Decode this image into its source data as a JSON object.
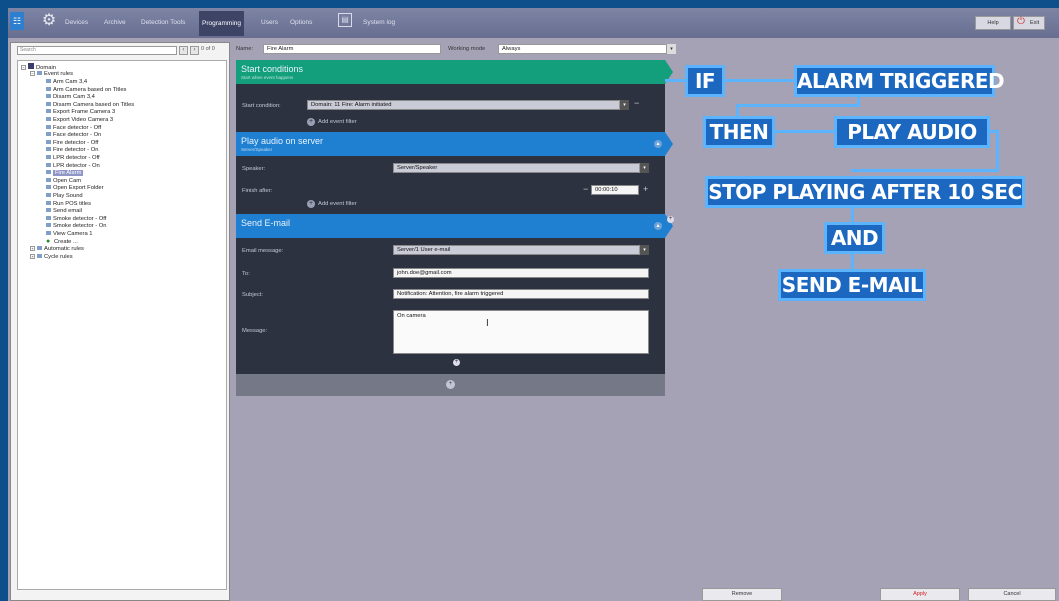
{
  "topbar": {
    "tabs": [
      "Devices",
      "Archive",
      "Detection Tools",
      "Programming",
      "Users",
      "Options"
    ],
    "active_tab": "Programming",
    "system_log": "System log",
    "help": "Help",
    "exit": "Exit",
    "logo_glyph": "☷",
    "gear_glyph": "⚙"
  },
  "tree_panel": {
    "search_placeholder": "Search",
    "count": "0 of 0",
    "prev_glyph": "‹",
    "next_glyph": "›",
    "root": "Domain",
    "event_rules": "Event rules",
    "items": [
      "Arm Cam 3,4",
      "Arm Camera based on Titles",
      "Disarm Cam 3,4",
      "Disarm Camera based on Titles",
      "Export Frame Camera 3",
      "Export Video Camera 3",
      "Face detector - Off",
      "Face detector - On",
      "Fire detector - Off",
      "Fire detector - On",
      "LPR detector - Off",
      "LPR detector - On",
      "Fire Alarm",
      "Open Cam",
      "Open Export Folder",
      "Play Sound",
      "Run POS titles",
      "Send email",
      "Smoke detector - Off",
      "Smoke detector - On",
      "View Camera 1"
    ],
    "create": "Create ...",
    "automatic_rules": "Automatic rules",
    "cycle_rules": "Cycle rules"
  },
  "name_bar": {
    "name_label": "Name:",
    "name_value": "Fire Alarm",
    "mode_label": "Working mode",
    "mode_value": "Always"
  },
  "editor": {
    "start_header": "Start conditions",
    "start_sub": "Start when event happens",
    "start_condition_label": "Start condition:",
    "start_condition_value": "Domain: 11 Fire: Alarm initiated",
    "add_event_filter": "Add event filter",
    "play_header": "Play audio on server",
    "play_sub": "Server/Speaker",
    "speaker_label": "Speaker:",
    "speaker_value": "Server/Speaker",
    "finish_label": "Finish after:",
    "finish_value": "00:00:10",
    "send_header": "Send E-mail",
    "email_message_label": "Email message:",
    "email_message_value": "Server/1 User e-mail",
    "to_label": "To:",
    "to_value": "john.doe@gmail.com",
    "subject_label": "Subject:",
    "subject_value": "Notification: Attention, fire alarm triggered",
    "message_label": "Message:",
    "message_value": "On camera"
  },
  "footer": {
    "remove": "Remove",
    "apply": "Apply",
    "cancel": "Cancel"
  },
  "annotations": {
    "if": "IF",
    "alarm": "ALARM TRIGGERED",
    "then": "THEN",
    "play": "PLAY AUDIO",
    "stop": "STOP PLAYING AFTER 10 SEC",
    "and": "AND",
    "send": "SEND E-MAIL"
  },
  "colors": {
    "background": "#0c4f8a",
    "start_header": "#139e7c",
    "action_header": "#1f7fd0",
    "annotation_fill": "#1c68c0",
    "annotation_border": "#5cb4ff"
  }
}
